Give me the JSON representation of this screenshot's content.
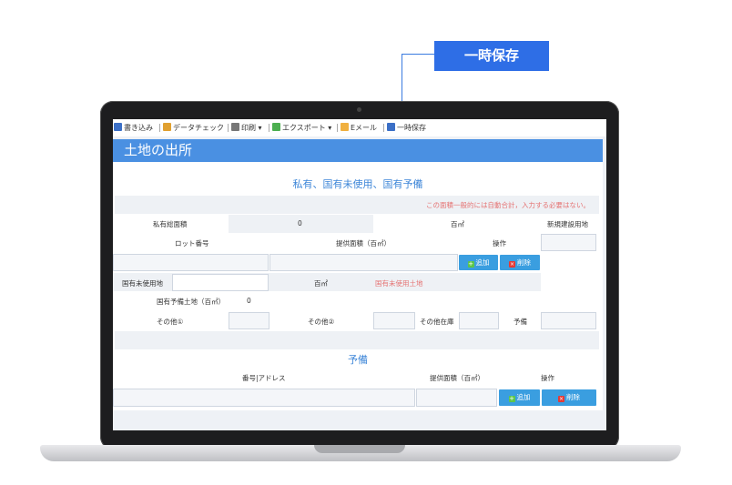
{
  "callout": {
    "label": "一時保存"
  },
  "toolbar": {
    "write": "書き込み",
    "data_check": "データチェック",
    "print": "印刷",
    "export": "エクスポート",
    "email": "Eメール",
    "temp_save": "一時保存"
  },
  "title": "土地の出所",
  "section1": {
    "heading": "私有、国有未使用、国有予備",
    "notice": "この面積一般的には自動合計，入力する必要はない。",
    "private_total_label": "私有総面積",
    "private_total_value": "0",
    "unit": "百㎡",
    "new_land_label": "新規建設用地",
    "lot_number_header": "ロット番号",
    "area_header": "提供面積（百㎡）",
    "operation_header": "操作",
    "add_button": "追加",
    "delete_button": "削除",
    "unused_label": "国有未使用地",
    "unused_unit": "百㎡",
    "unused_note": "国有未使用土地",
    "reserve_label": "国有予備土地（百㎡）",
    "reserve_value": "0",
    "other1_label": "その他①",
    "other2_label": "その他②",
    "other_stock_label": "その他在庫",
    "spare_label": "予備"
  },
  "section2": {
    "heading": "予備",
    "number_header": "番号|アドレス",
    "area_header": "提供面積（百㎡）",
    "operation_header": "操作",
    "add_button": "追加",
    "delete_button": "削除"
  }
}
